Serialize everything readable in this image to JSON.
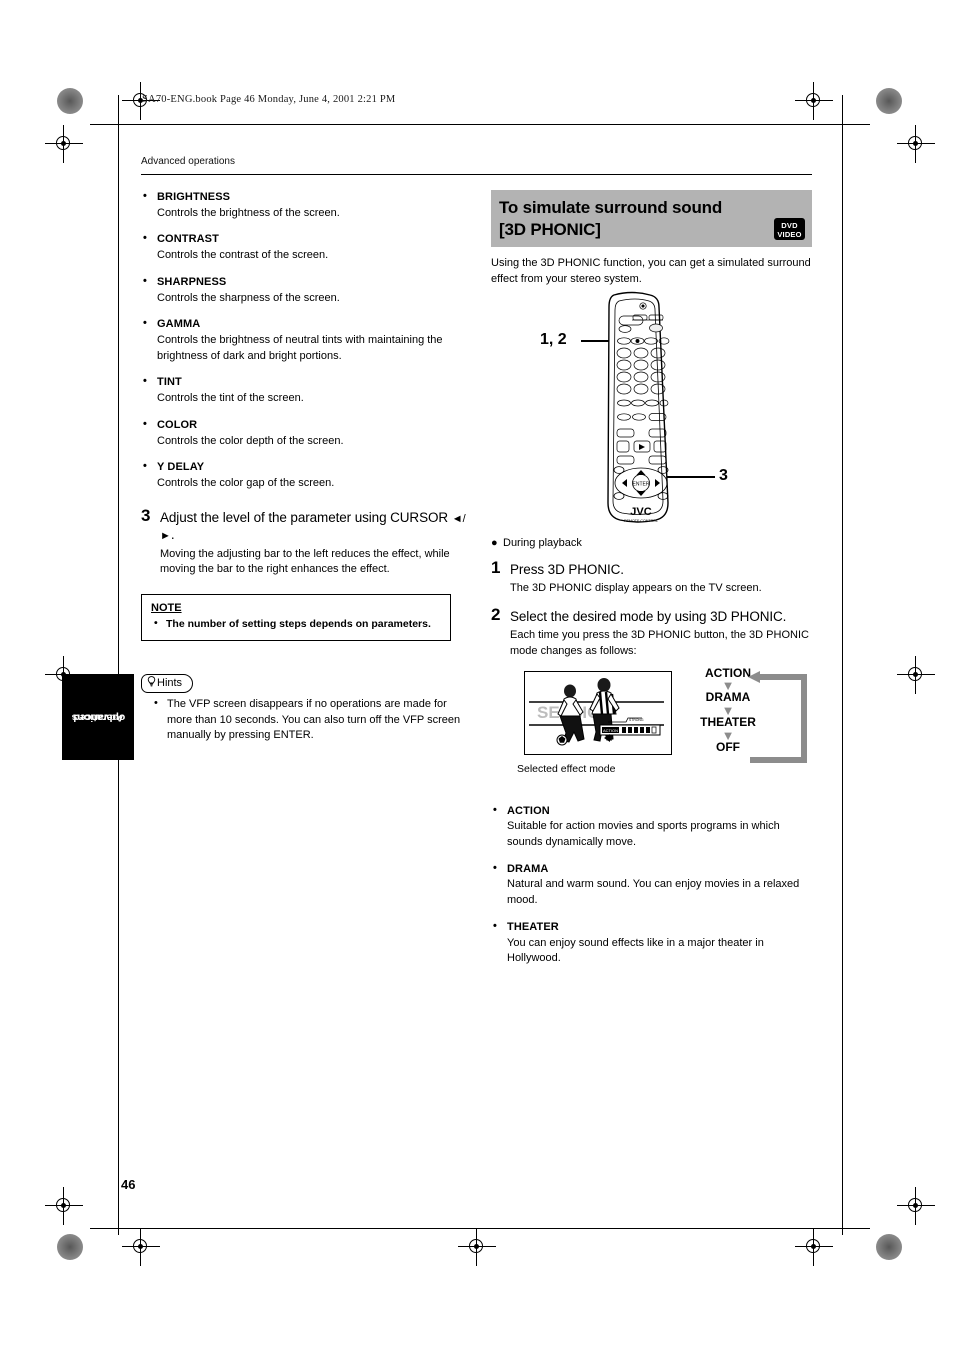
{
  "page": {
    "number": "46",
    "filestamp": "SA70-ENG.book  Page 46  Monday, June 4, 2001  2:21 PM",
    "running_head": "Advanced operations",
    "side_tab_line1": "Advanced",
    "side_tab_line2": "operations"
  },
  "left_column": {
    "parameters": [
      {
        "term": "BRIGHTNESS",
        "desc": "Controls the brightness of the screen."
      },
      {
        "term": "CONTRAST",
        "desc": "Controls the contrast of the screen."
      },
      {
        "term": "SHARPNESS",
        "desc": "Controls the sharpness of the screen."
      },
      {
        "term": "GAMMA",
        "desc": "Controls the brightness of neutral tints with maintaining the brightness of dark and bright portions."
      },
      {
        "term": "TINT",
        "desc": "Controls the tint of the screen."
      },
      {
        "term": "COLOR",
        "desc": "Controls the color depth of the screen."
      },
      {
        "term": "Y DELAY",
        "desc": "Controls the color gap of the screen."
      }
    ],
    "step3": {
      "number": "3",
      "title_part1": "Adjust the level of the parameter using CURSOR ",
      "title_arrows": "◄/►",
      "title_part2": ".",
      "body": "Moving the adjusting bar to the left reduces the effect, while moving the bar to the right enhances the effect."
    },
    "note": {
      "title": "NOTE",
      "item": "The number of setting steps depends on parameters."
    },
    "hints": {
      "label": "Hints",
      "item": "The VFP screen disappears if no operations are made for more than 10 seconds. You can also turn off the VFP screen manually by pressing ENTER."
    }
  },
  "right_column": {
    "heading_line1": "To simulate surround sound",
    "heading_line2": "[3D PHONIC]",
    "badge_line1": "DVD",
    "badge_line2": "VIDEO",
    "intro": "Using the 3D PHONIC function, you can get a simulated surround effect from your stereo system.",
    "remote": {
      "callout_steps": "1, 2",
      "callout_cursor": "3",
      "brand": "JVC",
      "brand_sub": "REMOTE CONTROL"
    },
    "during_playback": "During playback",
    "step1": {
      "number": "1",
      "title": "Press 3D PHONIC.",
      "body": "The 3D PHONIC display appears on the TV screen."
    },
    "step2": {
      "number": "2",
      "title": "Select the desired mode by using 3D PHONIC.",
      "body": "Each time you press the 3D PHONIC button, the 3D PHONIC mode changes as follows:"
    },
    "figure": {
      "tv_caption": "Selected effect mode",
      "osd_watermark": "SESSION",
      "osd_mode": "ACTION",
      "osd_strong": "STRONG",
      "cycle": [
        "ACTION",
        "DRAMA",
        "THEATER",
        "OFF"
      ],
      "arrow_glyph": "▼"
    },
    "modes": [
      {
        "term": "ACTION",
        "desc": "Suitable for action movies and sports programs in which sounds dynamically move."
      },
      {
        "term": "DRAMA",
        "desc": "Natural and warm sound. You can enjoy movies in a relaxed mood."
      },
      {
        "term": "THEATER",
        "desc": "You can enjoy sound effects like in a major theater in Hollywood."
      }
    ]
  },
  "colors": {
    "heading_bg": "#b3b3b3",
    "cycle_arrow": "#8c8c8c",
    "text": "#000000"
  }
}
